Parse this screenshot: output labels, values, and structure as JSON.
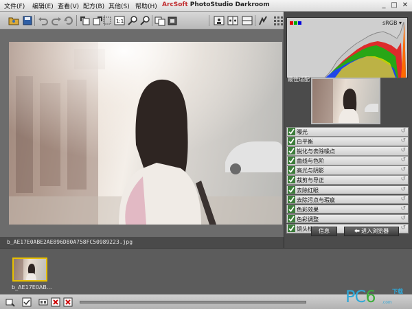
{
  "menu": [
    {
      "label": "文件(F)"
    },
    {
      "label": "编辑(E)"
    },
    {
      "label": "查看(V)"
    },
    {
      "label": "配方(B)"
    },
    {
      "label": "其他(S)"
    },
    {
      "label": "帮助(H)"
    }
  ],
  "app_title": {
    "brand": "ArcSoft",
    "name": " PhotoStudio Darkroom"
  },
  "window_buttons": {
    "minimize": "_",
    "maximize": "□",
    "close": "✕"
  },
  "histogram": {
    "color_space": "sRGB ▾"
  },
  "best_fit_label": "最佳适配",
  "adjustments": [
    {
      "label": "曝光"
    },
    {
      "label": "白平衡"
    },
    {
      "label": "锐化与去除噪点"
    },
    {
      "label": "曲线与色阶"
    },
    {
      "label": "高光与阴影"
    },
    {
      "label": "裁剪与导正"
    },
    {
      "label": "去除红眼"
    },
    {
      "label": "去除污点与瑕疵"
    },
    {
      "label": "色彩效果"
    },
    {
      "label": "色彩调整"
    },
    {
      "label": "镜头校正"
    }
  ],
  "filename": "b_AE17E0ABE2AE896D80A758FC50989223.jpg",
  "buttons": {
    "info": "信息",
    "enter_browser": "进入浏览器"
  },
  "filmstrip": {
    "caption": "b_AE17E0AB..."
  },
  "watermark": {
    "main_a": "PC",
    "main_b": "6",
    "main_c": ".com",
    "top": "下载"
  },
  "colors": {
    "check_green": "#3c7c3a",
    "film_highlight": "#e8c000",
    "accent_red": "#c0282a"
  }
}
